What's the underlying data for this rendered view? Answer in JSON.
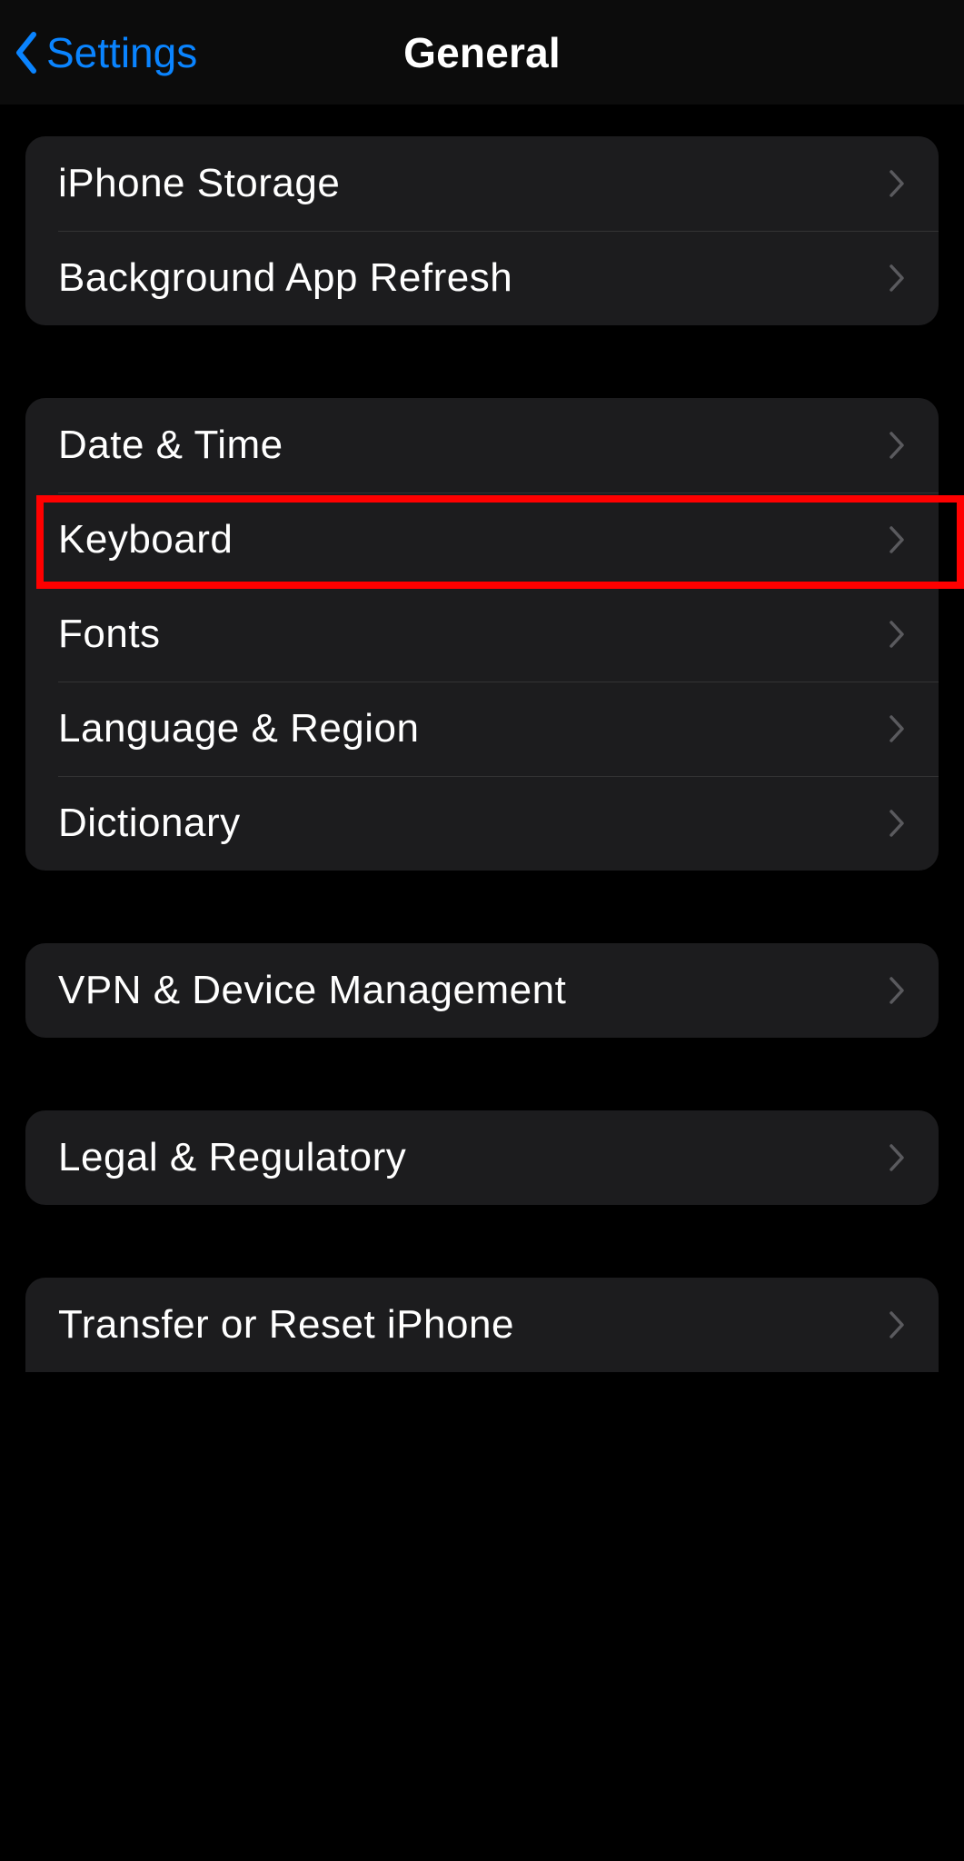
{
  "nav": {
    "back_label": "Settings",
    "title": "General"
  },
  "groups": [
    {
      "id": "storage-refresh",
      "rows": [
        {
          "id": "iphone-storage",
          "label": "iPhone Storage"
        },
        {
          "id": "background-app-refresh",
          "label": "Background App Refresh"
        }
      ]
    },
    {
      "id": "input-and-locale",
      "rows": [
        {
          "id": "date-time",
          "label": "Date & Time"
        },
        {
          "id": "keyboard",
          "label": "Keyboard",
          "highlighted": true
        },
        {
          "id": "fonts",
          "label": "Fonts"
        },
        {
          "id": "language-region",
          "label": "Language & Region"
        },
        {
          "id": "dictionary",
          "label": "Dictionary"
        }
      ]
    },
    {
      "id": "vpn",
      "rows": [
        {
          "id": "vpn-device-management",
          "label": "VPN & Device Management"
        }
      ]
    },
    {
      "id": "legal",
      "rows": [
        {
          "id": "legal-regulatory",
          "label": "Legal & Regulatory"
        }
      ]
    },
    {
      "id": "reset",
      "rows": [
        {
          "id": "transfer-reset",
          "label": "Transfer or Reset iPhone"
        }
      ]
    }
  ]
}
